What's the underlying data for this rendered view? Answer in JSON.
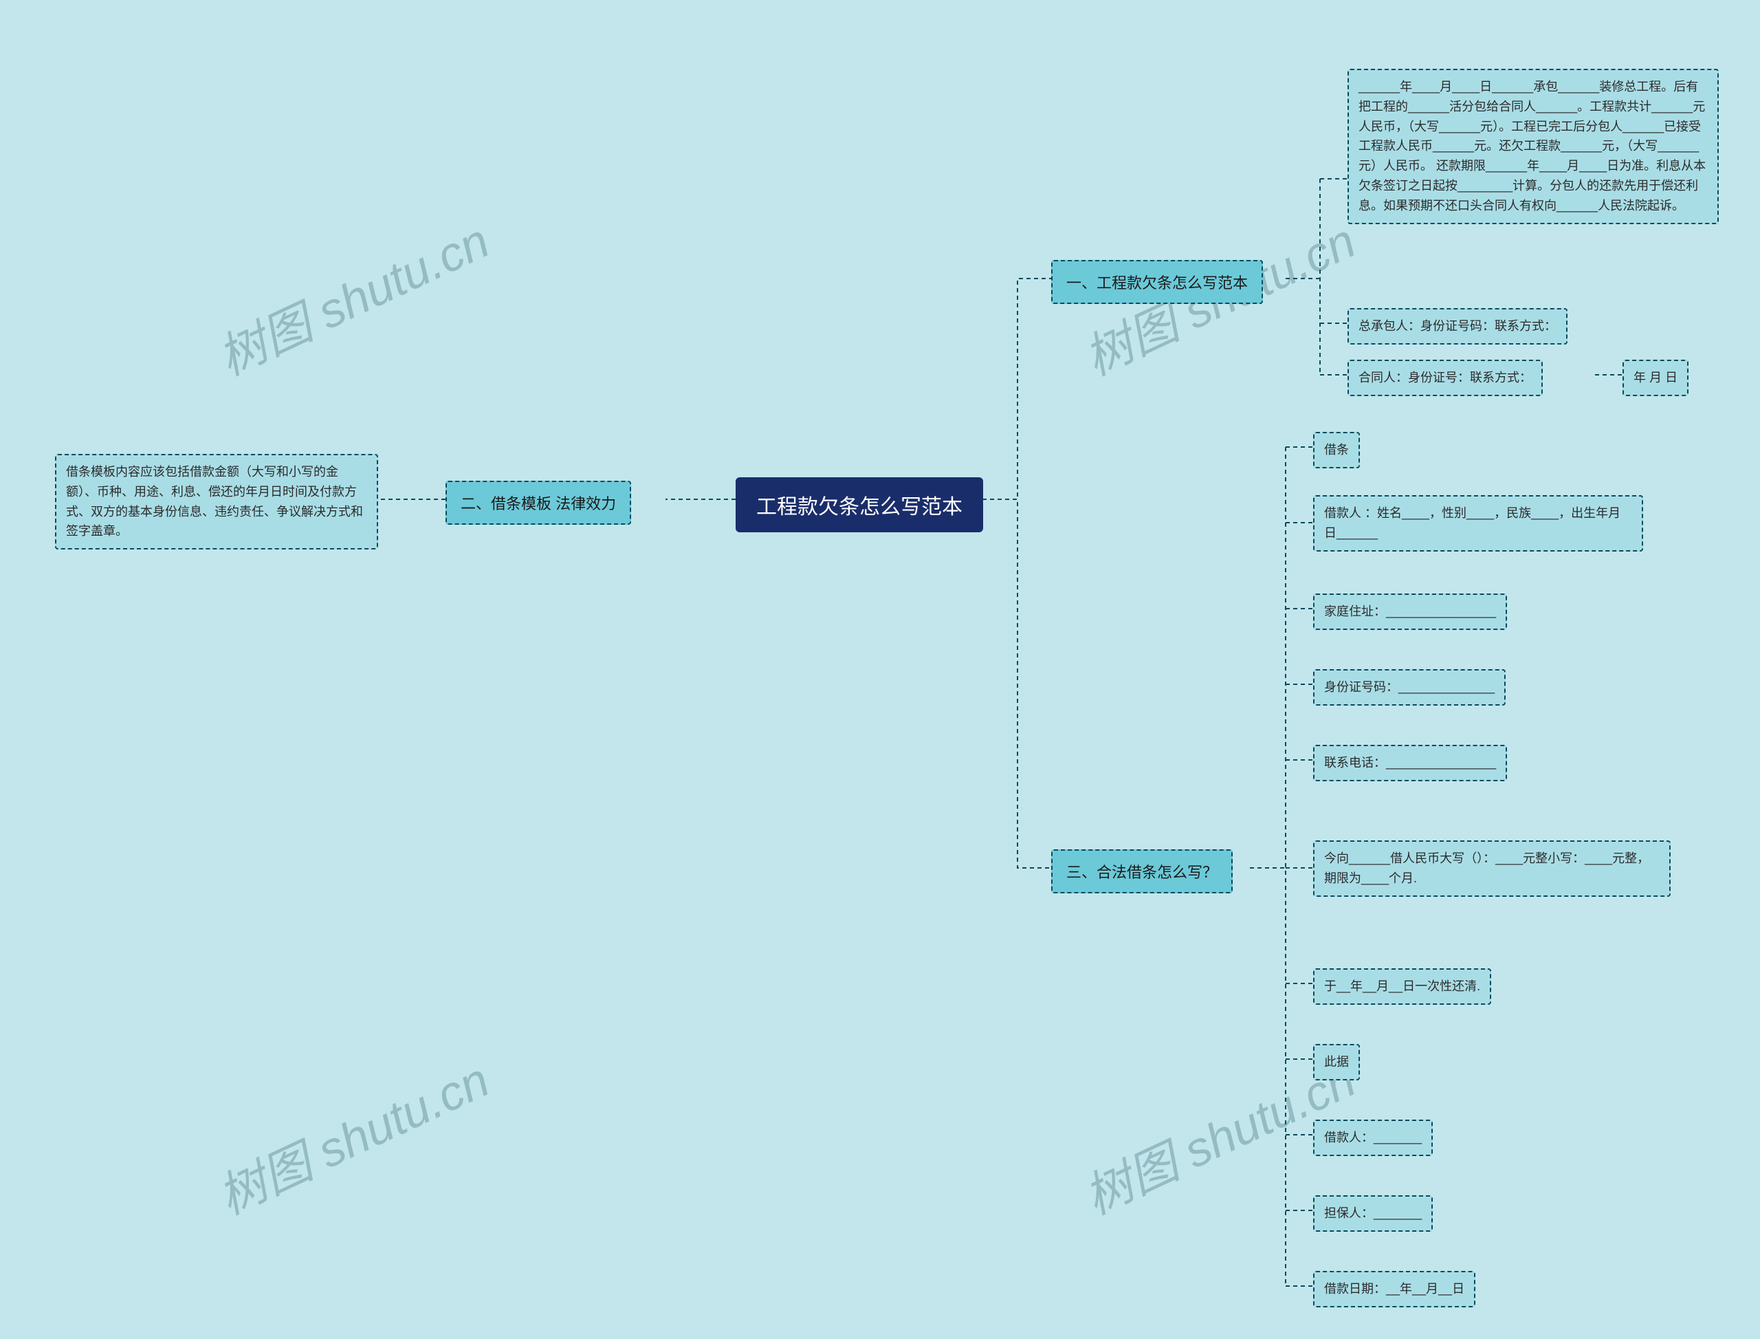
{
  "root": {
    "label": "工程款欠条怎么写范本"
  },
  "branch1": {
    "label": "一、工程款欠条怎么写范本",
    "leaves": [
      "______年____月____日______承包______装修总工程。后有把工程的______活分包给合同人______。工程款共计______元人民币，（大写______元）。工程已完工后分包人______已接受工程款人民币______元。还欠工程款______元，（大写______元）人民币。 还款期限______年____月____日为准。利息从本欠条签订之日起按________计算。分包人的还款先用于偿还利息。如果预期不还口头合同人有权向______人民法院起诉。",
      "总承包人：身份证号码：联系方式：",
      "合同人：身份证号：联系方式：",
      "年 月 日"
    ]
  },
  "branch2": {
    "label": "二、借条模板 法律效力",
    "leaf": "借条模板内容应该包括借款金额（大写和小写的金额）、币种、用途、利息、偿还的年月日时间及付款方式、双方的基本身份信息、违约责任、争议解决方式和签字盖章。"
  },
  "branch3": {
    "label": "三、合法借条怎么写？",
    "leaves": [
      "借条",
      "借款人 ：姓名____，性别____，民族____，出生年月日______",
      "家庭住址：________________",
      "身份证号码：______________",
      "联系电话：________________",
      "今向______借人民币大写（）：____元整小写：____元整，期限为____个月.",
      "于__年__月__日一次性还清.",
      "此据",
      "借款人：_______",
      "担保人：_______",
      "借款日期：__年__月__日"
    ]
  },
  "watermark": "树图 shutu.cn"
}
